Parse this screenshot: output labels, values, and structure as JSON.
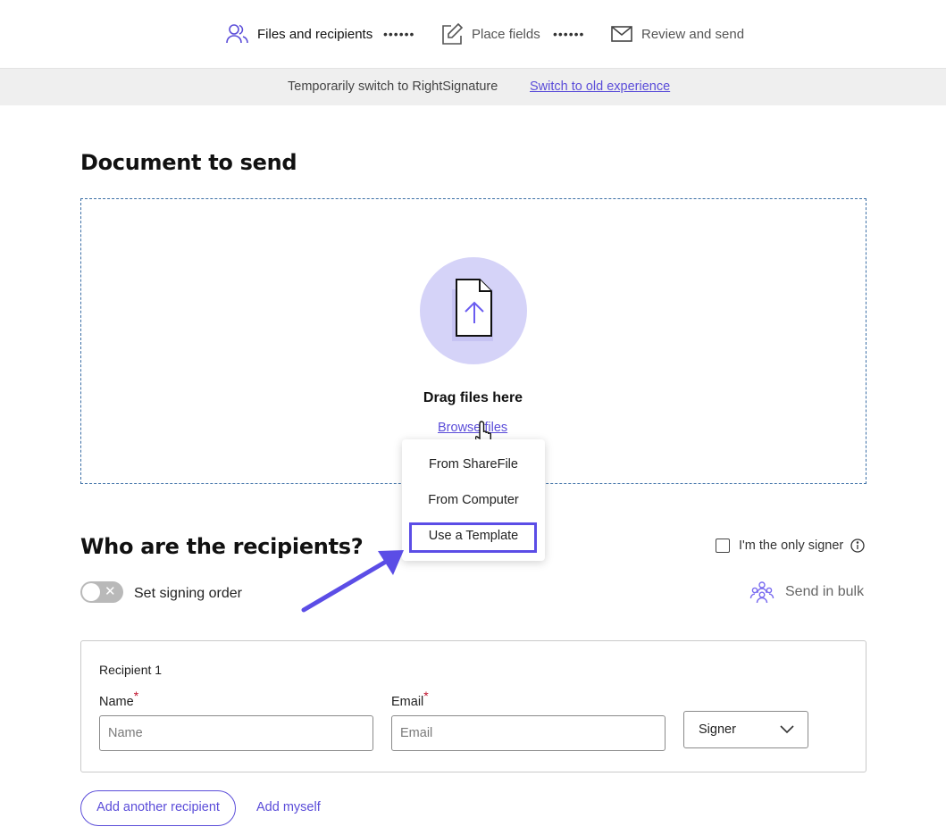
{
  "stepper": {
    "steps": [
      {
        "label": "Files and recipients",
        "icon": "people-icon",
        "active": true
      },
      {
        "label": "Place fields",
        "icon": "edit-icon",
        "active": false
      },
      {
        "label": "Review and send",
        "icon": "envelope-icon",
        "active": false
      }
    ],
    "separator": "••••••"
  },
  "banner": {
    "message": "Temporarily switch to RightSignature",
    "link": "Switch to old experience"
  },
  "document": {
    "heading": "Document to send",
    "drag_text": "Drag files here",
    "browse_link": "Browse files",
    "menu": [
      "From ShareFile",
      "From Computer",
      "Use a Template"
    ],
    "highlighted_item": "Use a Template"
  },
  "recipients": {
    "heading": "Who are the recipients?",
    "only_signer_label": "I'm the only signer",
    "signing_order_label": "Set signing order",
    "toggle_symbol": "✕",
    "send_bulk_label": "Send in bulk",
    "card": {
      "title": "Recipient 1",
      "name_label": "Name",
      "email_label": "Email",
      "required_mark": "*",
      "name_placeholder": "Name",
      "email_placeholder": "Email",
      "role": "Signer"
    },
    "add_recipient_label": "Add another recipient",
    "add_myself_label": "Add myself"
  },
  "colors": {
    "accent": "#5b4dd9",
    "upload_circle": "#d5d3f8",
    "required": "#c0152f"
  }
}
